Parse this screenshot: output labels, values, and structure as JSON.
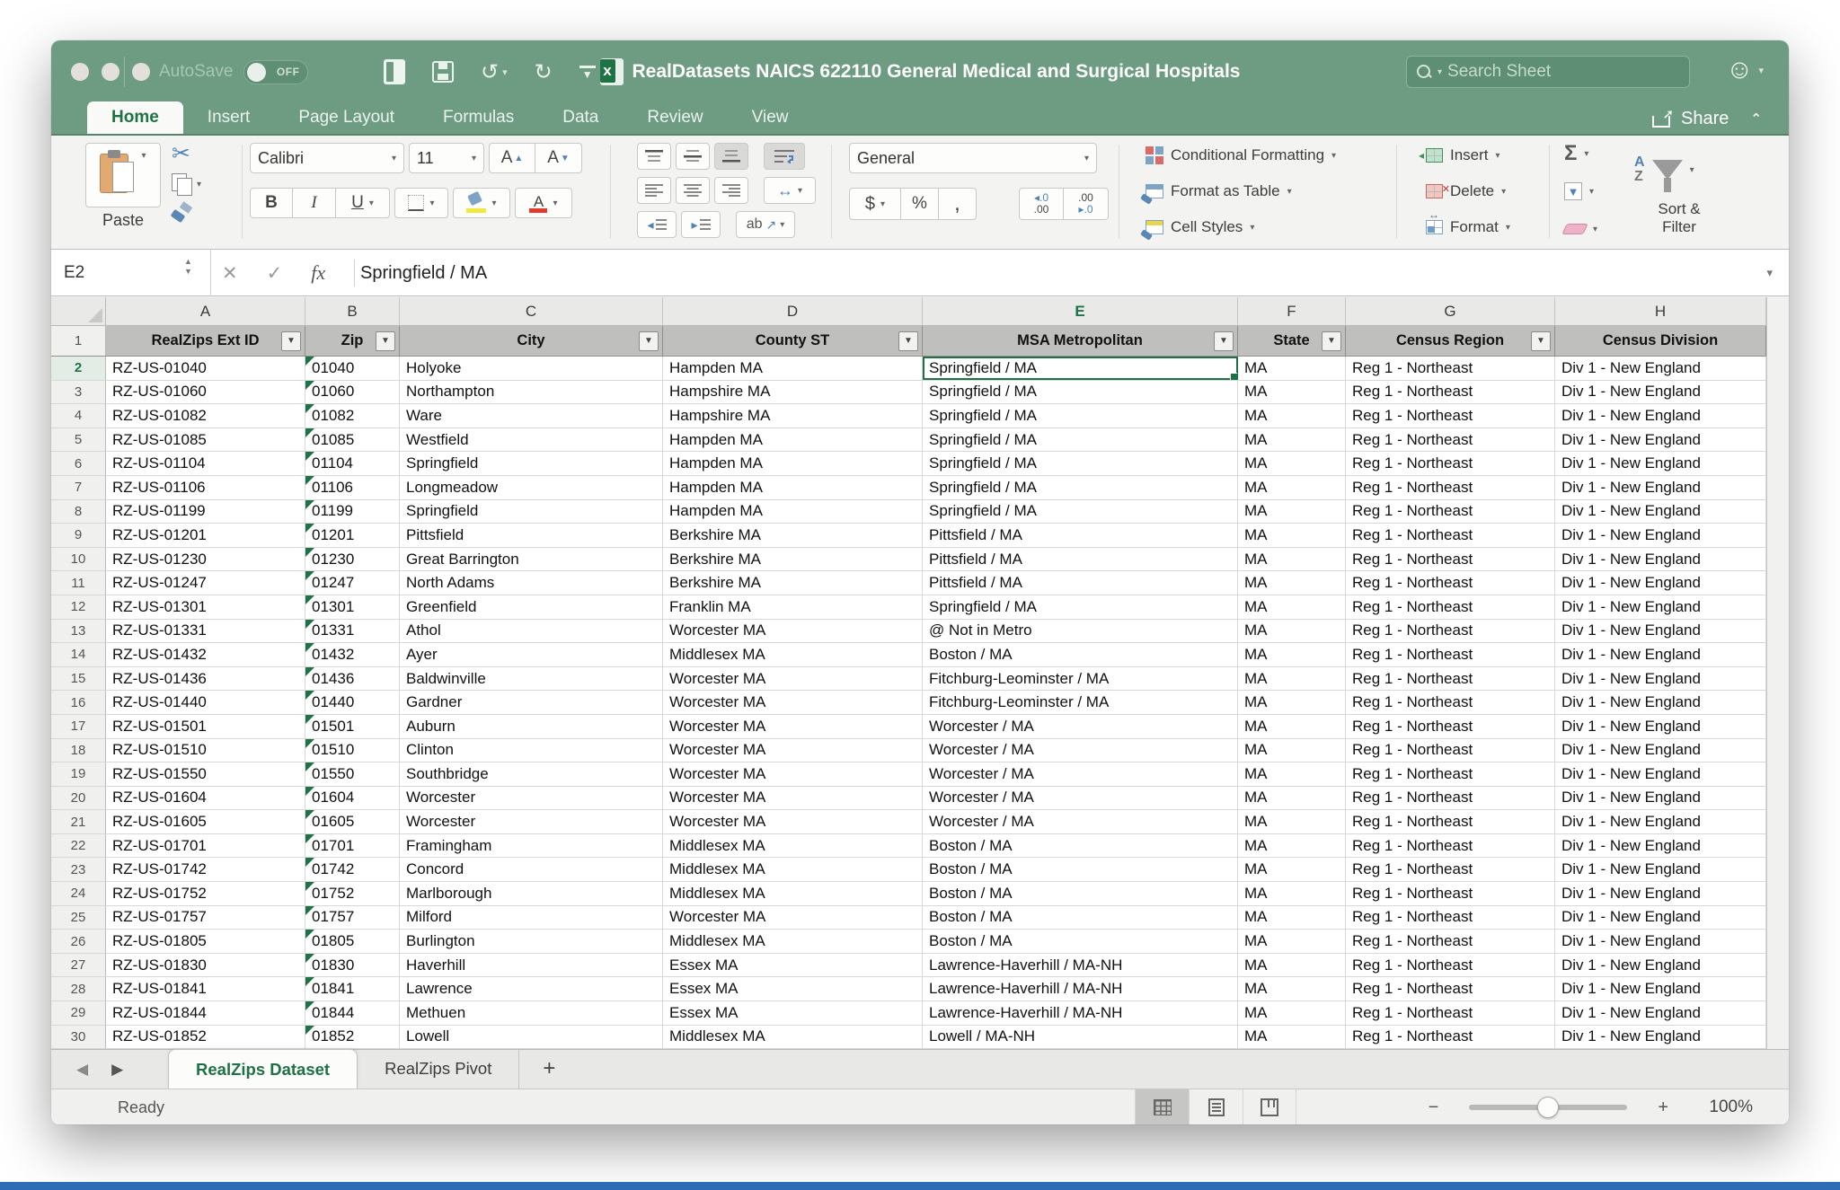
{
  "window": {
    "title": "RealDatasets NAICS 622110 General Medical and Surgical Hospitals"
  },
  "titlebar": {
    "autosave_label": "AutoSave",
    "autosave_state": "OFF",
    "search_placeholder": "Search Sheet",
    "share_label": "Share"
  },
  "ribbon_tabs": [
    {
      "label": "Home",
      "active": true
    },
    {
      "label": "Insert",
      "active": false
    },
    {
      "label": "Page Layout",
      "active": false
    },
    {
      "label": "Formulas",
      "active": false
    },
    {
      "label": "Data",
      "active": false
    },
    {
      "label": "Review",
      "active": false
    },
    {
      "label": "View",
      "active": false
    }
  ],
  "ribbon": {
    "paste_label": "Paste",
    "font_name": "Calibri",
    "font_size": "11",
    "number_format": "General",
    "conditional_formatting_label": "Conditional Formatting",
    "format_as_table_label": "Format as Table",
    "cell_styles_label": "Cell Styles",
    "insert_label": "Insert",
    "delete_label": "Delete",
    "format_label": "Format",
    "sort_filter_line1": "Sort &",
    "sort_filter_line2": "Filter"
  },
  "icons": {
    "dd": "▾",
    "dropdown": "▼",
    "up": "▲",
    "down": "▼",
    "undo": "↺",
    "redo": "↻",
    "scissors": "✂",
    "sum": "Σ",
    "cancel": "✕",
    "check": "✓",
    "fx": "fx",
    "smiley": "☺",
    "left": "◀",
    "right": "▶",
    "plus": "+",
    "minus": "−",
    "bold": "B",
    "italic": "I",
    "underline": "U",
    "dollar": "$",
    "percent": "%",
    "comma": ",",
    "arrow_lr": "↔",
    "arrow_ne": "↗",
    "ab": "ab",
    "a_letter": "A",
    "z_letter": "Z",
    "inc_dec_top": "◂.0",
    "inc_dec_bottom": ".00",
    "dec_dec_top": ".00",
    "dec_dec_bottom": "▸.0",
    "outdent": "◂",
    "indent": "▸",
    "filldown": "▼"
  },
  "formula_bar": {
    "cell_ref": "E2",
    "value": "Springfield / MA"
  },
  "grid": {
    "column_letters": [
      "A",
      "B",
      "C",
      "D",
      "E",
      "F",
      "G",
      "H"
    ],
    "active_column": "E",
    "header_row_number": "1",
    "headers": [
      {
        "label": "RealZips Ext ID",
        "filter": true
      },
      {
        "label": "Zip",
        "filter": true
      },
      {
        "label": "City",
        "filter": true
      },
      {
        "label": "County ST",
        "filter": true
      },
      {
        "label": "MSA Metropolitan",
        "filter": true
      },
      {
        "label": "State",
        "filter": true
      },
      {
        "label": "Census Region",
        "filter": true
      },
      {
        "label": "Census Division",
        "filter": false
      }
    ],
    "active_cell": {
      "ref": "E2",
      "row": 2,
      "col_index": 4
    },
    "rows": [
      [
        2,
        "RZ-US-01040",
        "01040",
        "Holyoke",
        "Hampden MA",
        "Springfield / MA",
        "MA",
        "Reg 1 - Northeast",
        "Div 1 - New England"
      ],
      [
        3,
        "RZ-US-01060",
        "01060",
        "Northampton",
        "Hampshire MA",
        "Springfield / MA",
        "MA",
        "Reg 1 - Northeast",
        "Div 1 - New England"
      ],
      [
        4,
        "RZ-US-01082",
        "01082",
        "Ware",
        "Hampshire MA",
        "Springfield / MA",
        "MA",
        "Reg 1 - Northeast",
        "Div 1 - New England"
      ],
      [
        5,
        "RZ-US-01085",
        "01085",
        "Westfield",
        "Hampden MA",
        "Springfield / MA",
        "MA",
        "Reg 1 - Northeast",
        "Div 1 - New England"
      ],
      [
        6,
        "RZ-US-01104",
        "01104",
        "Springfield",
        "Hampden MA",
        "Springfield / MA",
        "MA",
        "Reg 1 - Northeast",
        "Div 1 - New England"
      ],
      [
        7,
        "RZ-US-01106",
        "01106",
        "Longmeadow",
        "Hampden MA",
        "Springfield / MA",
        "MA",
        "Reg 1 - Northeast",
        "Div 1 - New England"
      ],
      [
        8,
        "RZ-US-01199",
        "01199",
        "Springfield",
        "Hampden MA",
        "Springfield / MA",
        "MA",
        "Reg 1 - Northeast",
        "Div 1 - New England"
      ],
      [
        9,
        "RZ-US-01201",
        "01201",
        "Pittsfield",
        "Berkshire MA",
        "Pittsfield / MA",
        "MA",
        "Reg 1 - Northeast",
        "Div 1 - New England"
      ],
      [
        10,
        "RZ-US-01230",
        "01230",
        "Great Barrington",
        "Berkshire MA",
        "Pittsfield / MA",
        "MA",
        "Reg 1 - Northeast",
        "Div 1 - New England"
      ],
      [
        11,
        "RZ-US-01247",
        "01247",
        "North Adams",
        "Berkshire MA",
        "Pittsfield / MA",
        "MA",
        "Reg 1 - Northeast",
        "Div 1 - New England"
      ],
      [
        12,
        "RZ-US-01301",
        "01301",
        "Greenfield",
        "Franklin MA",
        "Springfield / MA",
        "MA",
        "Reg 1 - Northeast",
        "Div 1 - New England"
      ],
      [
        13,
        "RZ-US-01331",
        "01331",
        "Athol",
        "Worcester MA",
        "@ Not in Metro",
        "MA",
        "Reg 1 - Northeast",
        "Div 1 - New England"
      ],
      [
        14,
        "RZ-US-01432",
        "01432",
        "Ayer",
        "Middlesex MA",
        "Boston / MA",
        "MA",
        "Reg 1 - Northeast",
        "Div 1 - New England"
      ],
      [
        15,
        "RZ-US-01436",
        "01436",
        "Baldwinville",
        "Worcester MA",
        "Fitchburg-Leominster / MA",
        "MA",
        "Reg 1 - Northeast",
        "Div 1 - New England"
      ],
      [
        16,
        "RZ-US-01440",
        "01440",
        "Gardner",
        "Worcester MA",
        "Fitchburg-Leominster / MA",
        "MA",
        "Reg 1 - Northeast",
        "Div 1 - New England"
      ],
      [
        17,
        "RZ-US-01501",
        "01501",
        "Auburn",
        "Worcester MA",
        "Worcester / MA",
        "MA",
        "Reg 1 - Northeast",
        "Div 1 - New England"
      ],
      [
        18,
        "RZ-US-01510",
        "01510",
        "Clinton",
        "Worcester MA",
        "Worcester / MA",
        "MA",
        "Reg 1 - Northeast",
        "Div 1 - New England"
      ],
      [
        19,
        "RZ-US-01550",
        "01550",
        "Southbridge",
        "Worcester MA",
        "Worcester / MA",
        "MA",
        "Reg 1 - Northeast",
        "Div 1 - New England"
      ],
      [
        20,
        "RZ-US-01604",
        "01604",
        "Worcester",
        "Worcester MA",
        "Worcester / MA",
        "MA",
        "Reg 1 - Northeast",
        "Div 1 - New England"
      ],
      [
        21,
        "RZ-US-01605",
        "01605",
        "Worcester",
        "Worcester MA",
        "Worcester / MA",
        "MA",
        "Reg 1 - Northeast",
        "Div 1 - New England"
      ],
      [
        22,
        "RZ-US-01701",
        "01701",
        "Framingham",
        "Middlesex MA",
        "Boston / MA",
        "MA",
        "Reg 1 - Northeast",
        "Div 1 - New England"
      ],
      [
        23,
        "RZ-US-01742",
        "01742",
        "Concord",
        "Middlesex MA",
        "Boston / MA",
        "MA",
        "Reg 1 - Northeast",
        "Div 1 - New England"
      ],
      [
        24,
        "RZ-US-01752",
        "01752",
        "Marlborough",
        "Middlesex MA",
        "Boston / MA",
        "MA",
        "Reg 1 - Northeast",
        "Div 1 - New England"
      ],
      [
        25,
        "RZ-US-01757",
        "01757",
        "Milford",
        "Worcester MA",
        "Boston / MA",
        "MA",
        "Reg 1 - Northeast",
        "Div 1 - New England"
      ],
      [
        26,
        "RZ-US-01805",
        "01805",
        "Burlington",
        "Middlesex MA",
        "Boston / MA",
        "MA",
        "Reg 1 - Northeast",
        "Div 1 - New England"
      ],
      [
        27,
        "RZ-US-01830",
        "01830",
        "Haverhill",
        "Essex MA",
        "Lawrence-Haverhill / MA-NH",
        "MA",
        "Reg 1 - Northeast",
        "Div 1 - New England"
      ],
      [
        28,
        "RZ-US-01841",
        "01841",
        "Lawrence",
        "Essex MA",
        "Lawrence-Haverhill / MA-NH",
        "MA",
        "Reg 1 - Northeast",
        "Div 1 - New England"
      ],
      [
        29,
        "RZ-US-01844",
        "01844",
        "Methuen",
        "Essex MA",
        "Lawrence-Haverhill / MA-NH",
        "MA",
        "Reg 1 - Northeast",
        "Div 1 - New England"
      ],
      [
        30,
        "RZ-US-01852",
        "01852",
        "Lowell",
        "Middlesex MA",
        "Lowell / MA-NH",
        "MA",
        "Reg 1 - Northeast",
        "Div 1 - New England"
      ]
    ]
  },
  "sheet_tabs": {
    "tabs": [
      {
        "label": "RealZips Dataset",
        "active": true
      },
      {
        "label": "RealZips Pivot",
        "active": false
      }
    ],
    "add_label": "+"
  },
  "status_bar": {
    "ready": "Ready",
    "zoom": "100%"
  },
  "colors": {
    "titlebar_green": "#6d9c83",
    "excel_green": "#1f7246",
    "header_gray": "#bfbfbd"
  }
}
